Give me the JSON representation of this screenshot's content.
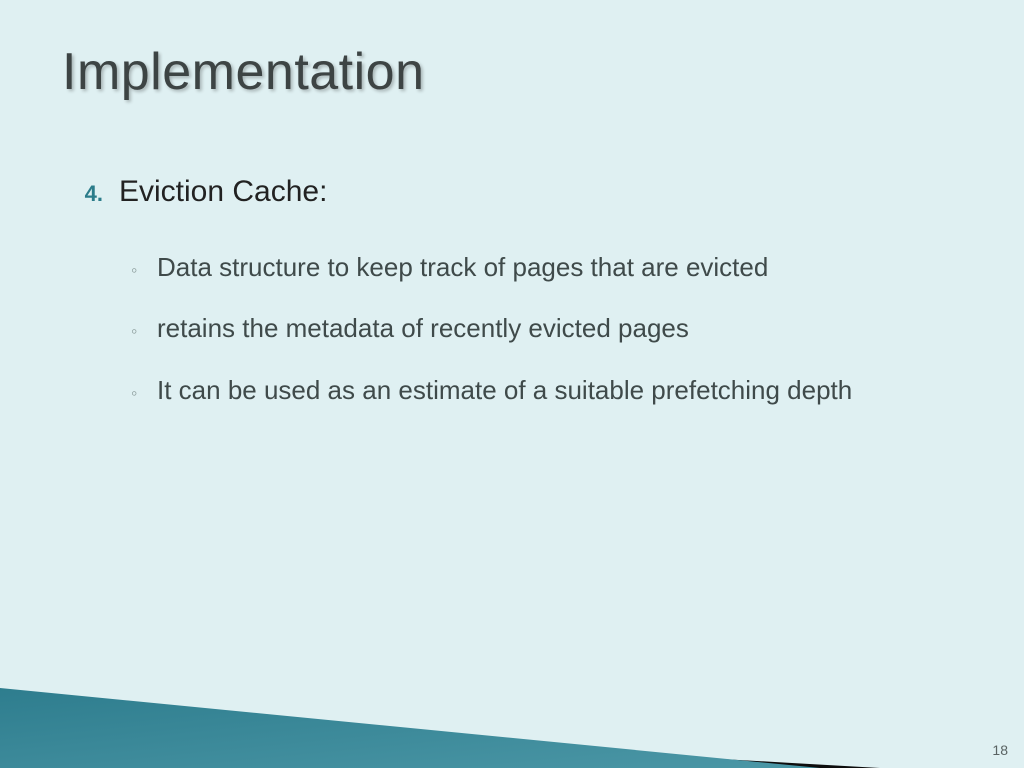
{
  "title": "Implementation",
  "list": {
    "start_number": "4.",
    "heading": "Eviction Cache:",
    "bullets": [
      "Data structure to keep track of pages that are evicted",
      "retains the metadata of recently evicted pages",
      "It can be used as an estimate of a suitable prefetching depth"
    ]
  },
  "page_number": "18"
}
